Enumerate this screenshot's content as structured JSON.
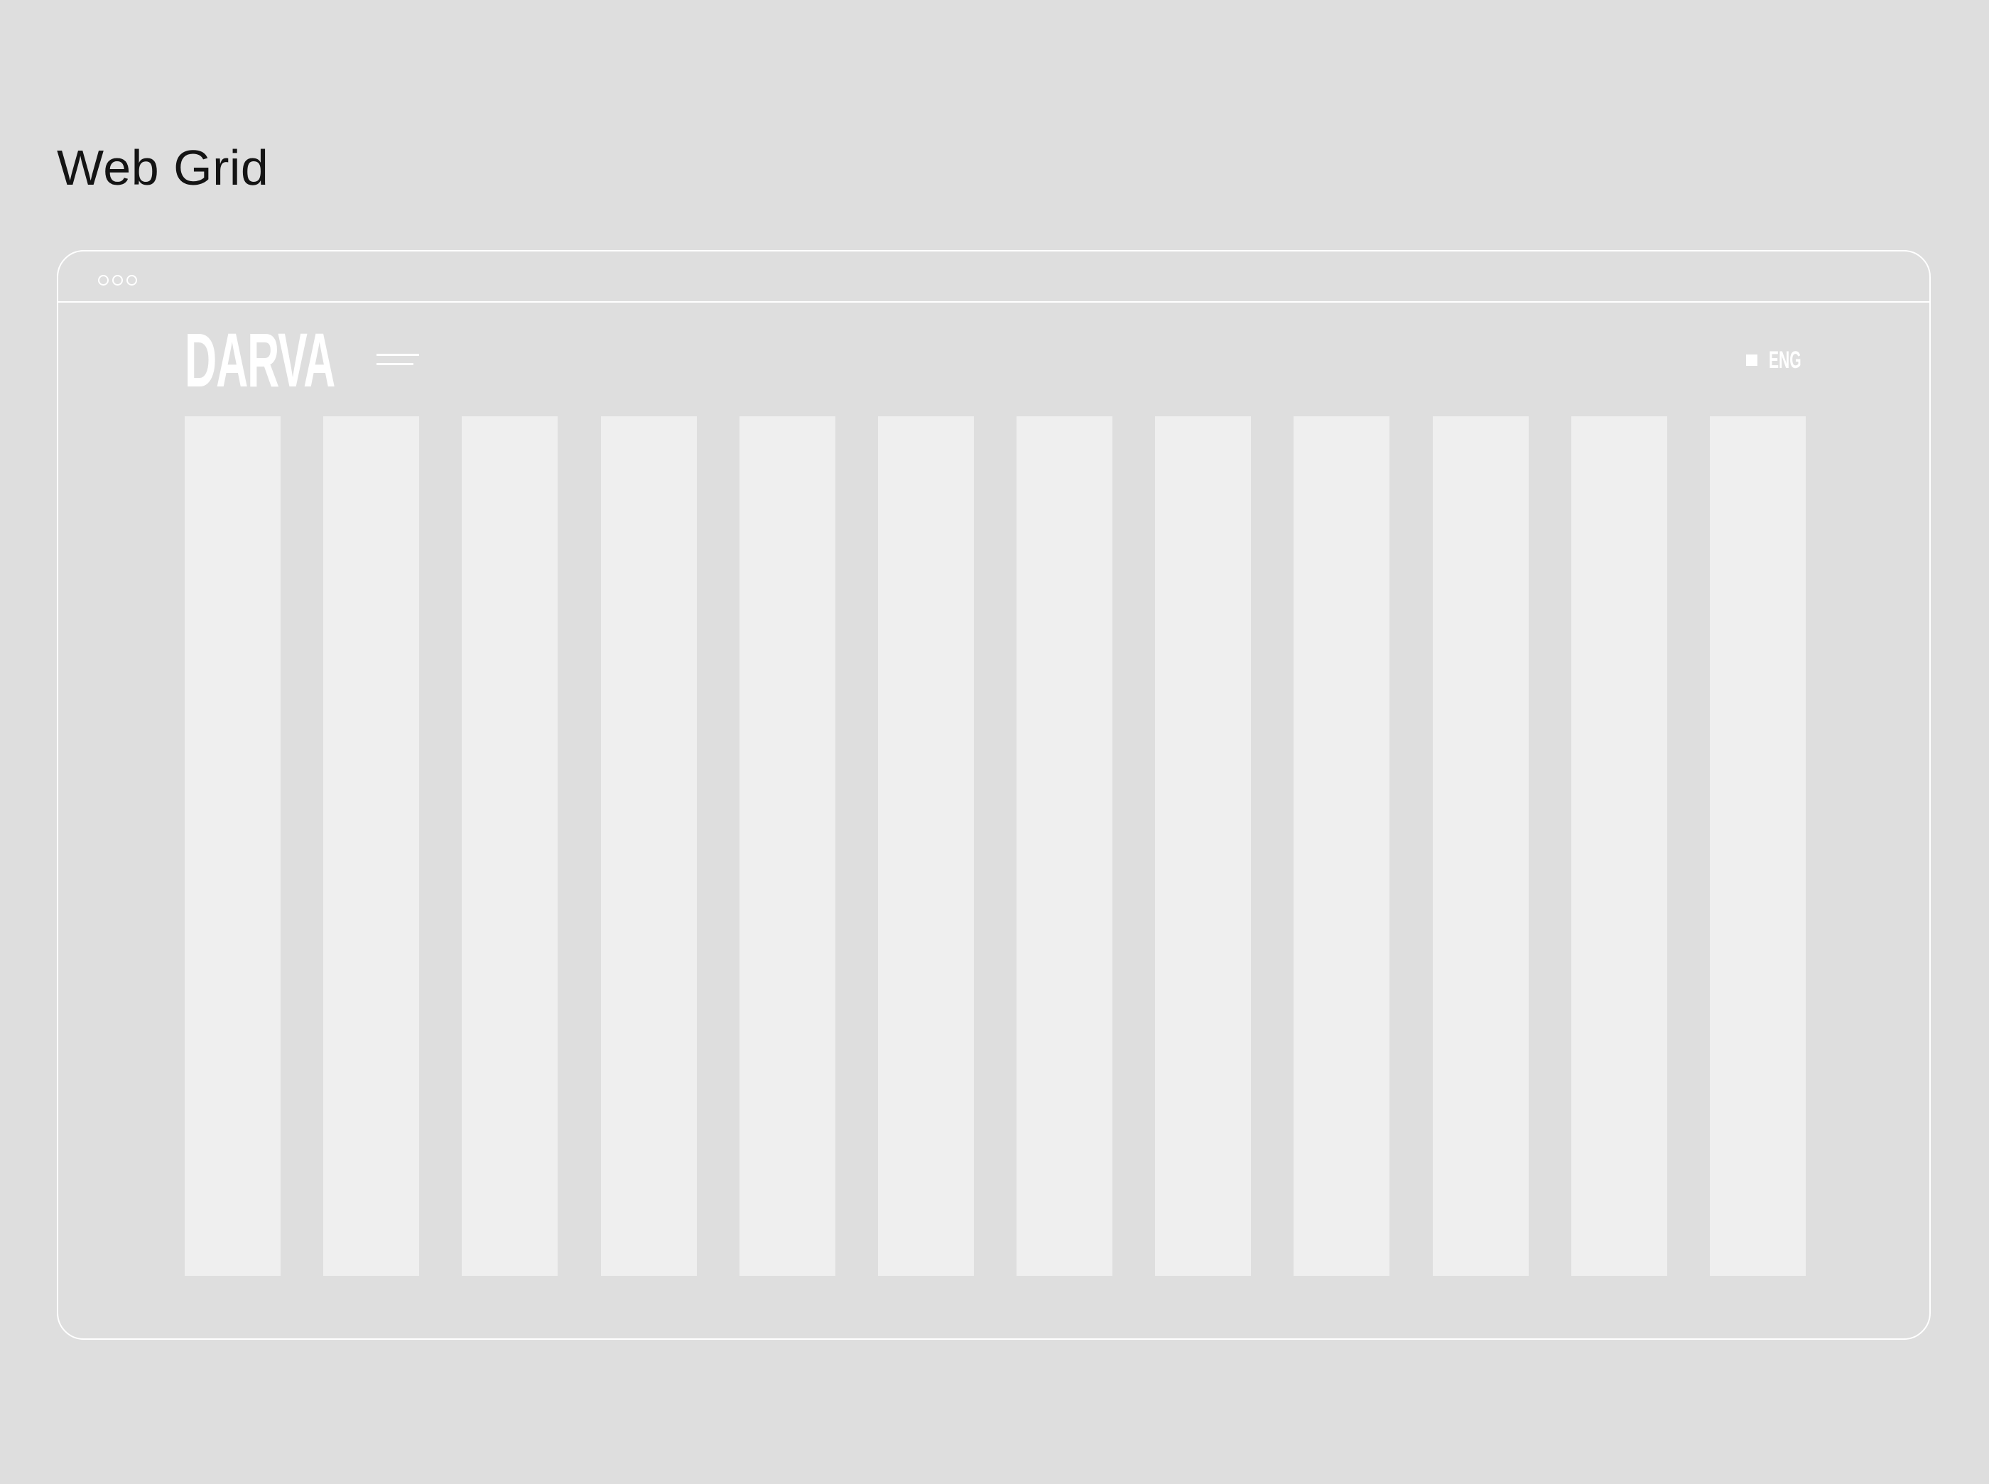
{
  "page": {
    "title": "Web Grid"
  },
  "browser": {
    "window_dots": [
      "dot",
      "dot",
      "dot"
    ],
    "brand": {
      "logo_text": "DARVA"
    },
    "menu_icon": "hamburger-icon",
    "language": {
      "label": "ENG",
      "indicator_icon": "square-icon"
    },
    "grid": {
      "columns": 12
    }
  },
  "colors": {
    "background": "#dedede",
    "column_fill": "#efefef",
    "outline": "#ffffff",
    "title_text": "#141414"
  }
}
